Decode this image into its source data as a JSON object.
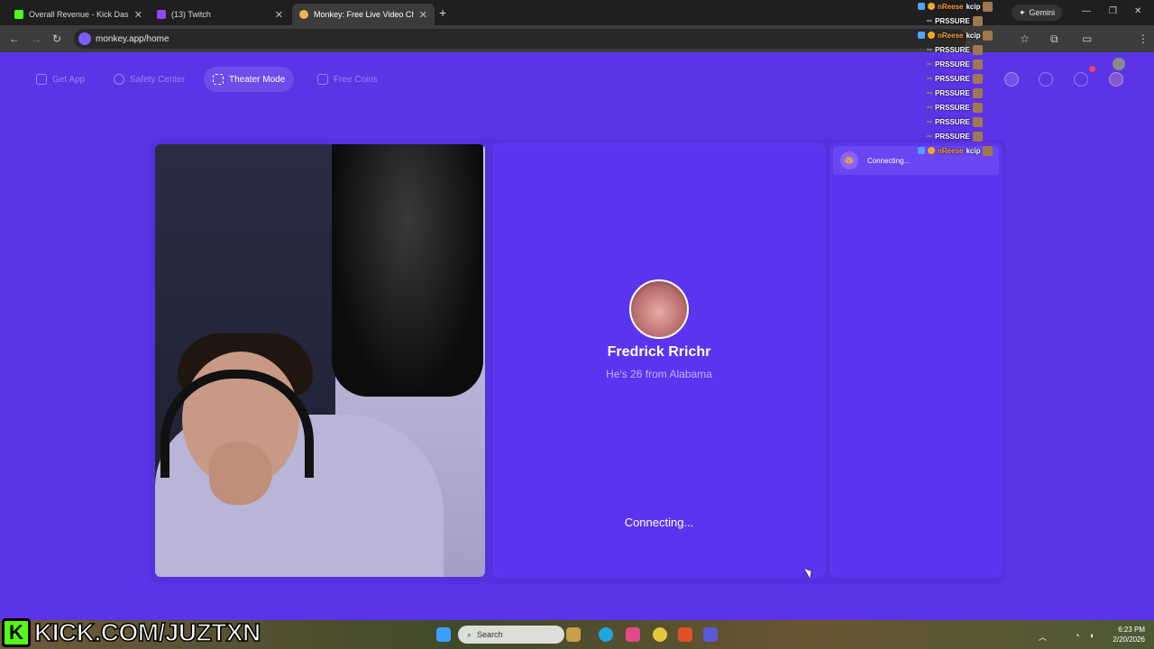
{
  "browser": {
    "tabs": [
      {
        "title": "Overall Revenue - Kick Dashbo",
        "favicon": "kick-icon",
        "color": "#53fc18"
      },
      {
        "title": "(13) Twitch",
        "favicon": "twitch-icon",
        "color": "#9146ff"
      },
      {
        "title": "Monkey: Free Live Video Ch",
        "favicon": "monkey-icon",
        "color": "#f0b24a"
      }
    ],
    "url": "monkey.app/home",
    "gemini_label": "Gemini"
  },
  "site_nav": {
    "get_app": "Get App",
    "safety_center": "Safety Center",
    "theater_mode": "Theater Mode",
    "free_coins": "Free Coins"
  },
  "match": {
    "name": "Fredrick Rrichr",
    "subtitle": "He's 26 from Alabama",
    "status": "Connecting..."
  },
  "chat": {
    "status": "Connecting..."
  },
  "stream_overlay": [
    {
      "user": "nReese",
      "text": "kcip",
      "type": "user"
    },
    {
      "user": "",
      "text": "PRSSURE",
      "type": "spam"
    },
    {
      "user": "nReese",
      "text": "kcip",
      "type": "user"
    },
    {
      "user": "",
      "text": "PRSSURE",
      "type": "spam"
    },
    {
      "user": "",
      "text": "PRSSURE",
      "type": "spam"
    },
    {
      "user": "",
      "text": "PRSSURE",
      "type": "spam"
    },
    {
      "user": "",
      "text": "PRSSURE",
      "type": "spam"
    },
    {
      "user": "",
      "text": "PRSSURE",
      "type": "spam"
    },
    {
      "user": "",
      "text": "PRSSURE",
      "type": "spam"
    },
    {
      "user": "",
      "text": "PRSSURE",
      "type": "spam"
    },
    {
      "user": "nReese",
      "text": "kcip",
      "type": "user"
    }
  ],
  "watermark": {
    "logo_letter": "K",
    "url": "KICK.COM/JUZTXN"
  },
  "taskbar": {
    "search": "Search",
    "time": "6:23 PM",
    "date": "2/20/2026"
  },
  "colors": {
    "accent": "#5b34e6",
    "kick_green": "#53fc18"
  }
}
